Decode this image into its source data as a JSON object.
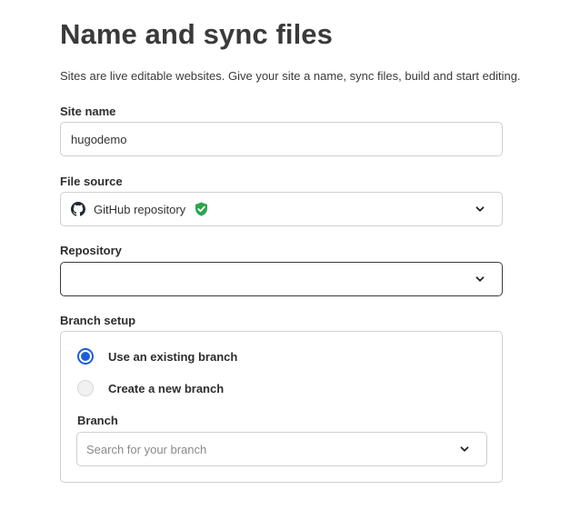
{
  "header": {
    "title": "Name and sync files",
    "subtitle": "Sites are live editable websites. Give your site a name, sync files, build and start editing."
  },
  "site_name": {
    "label": "Site name",
    "value": "hugodemo"
  },
  "file_source": {
    "label": "File source",
    "value": "GitHub repository",
    "icon": "github-icon",
    "badge_icon": "verified-shield-icon",
    "badge_color": "#2da44e"
  },
  "repository": {
    "label": "Repository",
    "value": ""
  },
  "branch_setup": {
    "label": "Branch setup",
    "options": [
      {
        "label": "Use an existing branch",
        "selected": true
      },
      {
        "label": "Create a new branch",
        "selected": false
      }
    ],
    "branch": {
      "label": "Branch",
      "placeholder": "Search for your branch"
    }
  },
  "colors": {
    "accent": "#1d5fd6",
    "border": "#cfcfcf",
    "text": "#2d2d2d"
  }
}
